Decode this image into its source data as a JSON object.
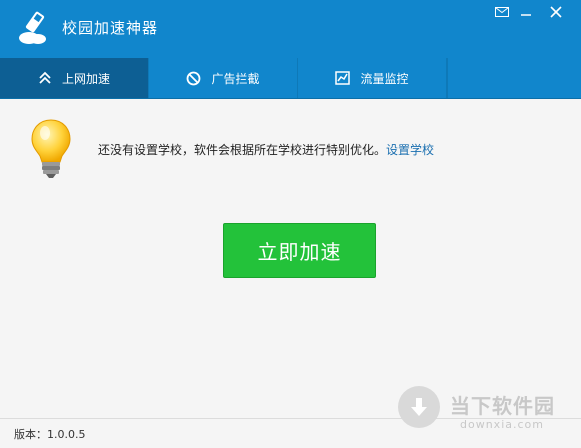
{
  "app": {
    "title": "校园加速神器"
  },
  "window_controls": {
    "mail_icon": "mail-icon",
    "minimize_icon": "minimize-icon",
    "close_icon": "close-icon"
  },
  "tabs": [
    {
      "label": "上网加速",
      "icon": "double-chevron-up-icon",
      "active": true
    },
    {
      "label": "广告拦截",
      "icon": "block-icon",
      "active": false
    },
    {
      "label": "流量监控",
      "icon": "chart-icon",
      "active": false
    }
  ],
  "notice": {
    "text": "还没有设置学校，软件会根据所在学校进行特别优化。",
    "link": "设置学校"
  },
  "main_button": {
    "label": "立即加速"
  },
  "footer": {
    "version": "版本：1.0.0.5"
  },
  "watermark": {
    "title": "当下软件园",
    "sub": "downxia.com"
  },
  "colors": {
    "header": "#1186cc",
    "active_tab": "#0d5f94",
    "button": "#23c23a",
    "link": "#1a6fb0"
  }
}
